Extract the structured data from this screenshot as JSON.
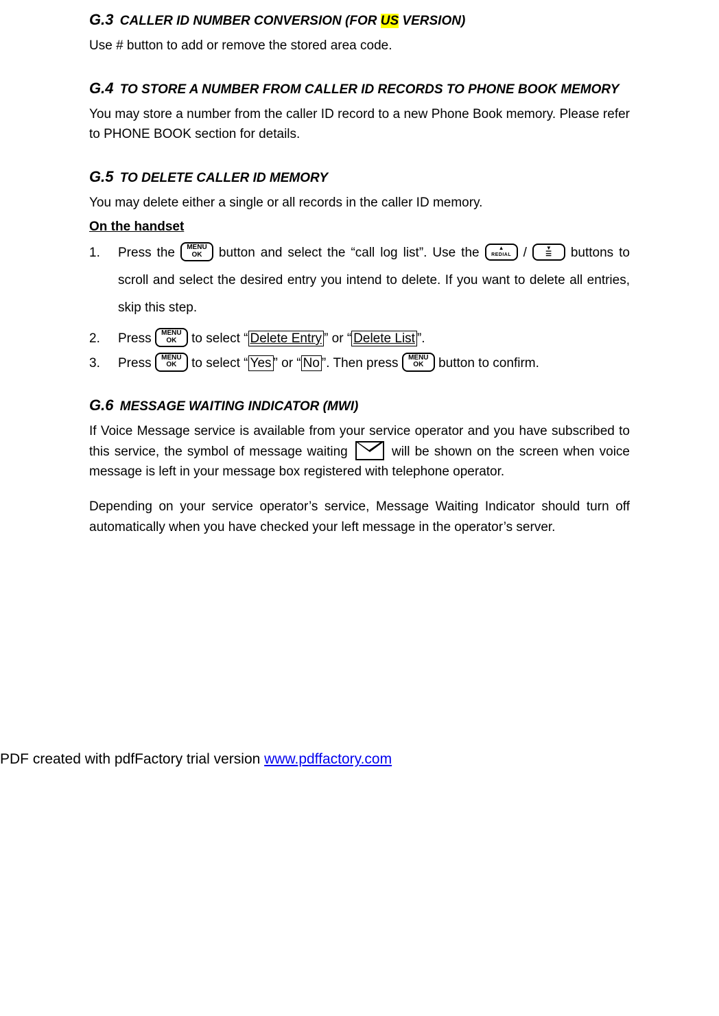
{
  "g3": {
    "num": "G.3",
    "title_pre": " CALLER ID NUMBER CONVERSION (FOR ",
    "title_hl": "US",
    "title_post": " VERSION)",
    "body": "Use # button to add or remove the stored area code."
  },
  "g4": {
    "num": "G.4",
    "title": " TO STORE A NUMBER FROM CALLER ID RECORDS TO PHONE BOOK MEMORY",
    "body": "You may store a number from the caller ID record to a new Phone Book memory. Please refer to PHONE BOOK section for details."
  },
  "g5": {
    "num": "G.5",
    "title": " TO DELETE CALLER ID MEMORY",
    "intro": "You may delete either a single or all records in the caller ID memory.",
    "subhead": "On the handset",
    "step1_a": "Press the ",
    "step1_b": " button and select the “call log list”. Use the ",
    "step1_slash": " / ",
    "step1_c": " buttons to scroll and select the desired entry you intend to delete. If you want to delete all entries, skip this step.",
    "step2_a": "Press ",
    "step2_b": " to select “",
    "step2_opt1": "Delete Entry",
    "step2_mid": "” or “",
    "step2_opt2": "Delete List",
    "step2_end": "”.",
    "step3_a": "Press ",
    "step3_b": " to select “",
    "step3_yes": "Yes",
    "step3_mid": "” or “",
    "step3_no": "No",
    "step3_c": "”. Then press ",
    "step3_d": " button to confirm."
  },
  "g6": {
    "num": "G.6",
    "title": " MESSAGE WAITING INDICATOR (MWI)",
    "p1_a": "If Voice Message service is available from your service operator and you have subscribed to this service, the symbol of message waiting ",
    "p1_b": " will be shown on the screen when voice message is left in your message box registered with telephone operator.",
    "p2": "Depending on your service operator’s service, Message Waiting Indicator should turn off automatically when you have checked your left message in the operator’s server."
  },
  "buttons": {
    "menu_l1": "MENU",
    "menu_l2": "OK",
    "up_arrow": "▲",
    "up_label": "REDIAL",
    "down_arrow": "▼",
    "down_label": "☰"
  },
  "footer": {
    "prefix": "PDF created with pdfFactory trial version ",
    "link_text": "www.pdffactory.com"
  }
}
